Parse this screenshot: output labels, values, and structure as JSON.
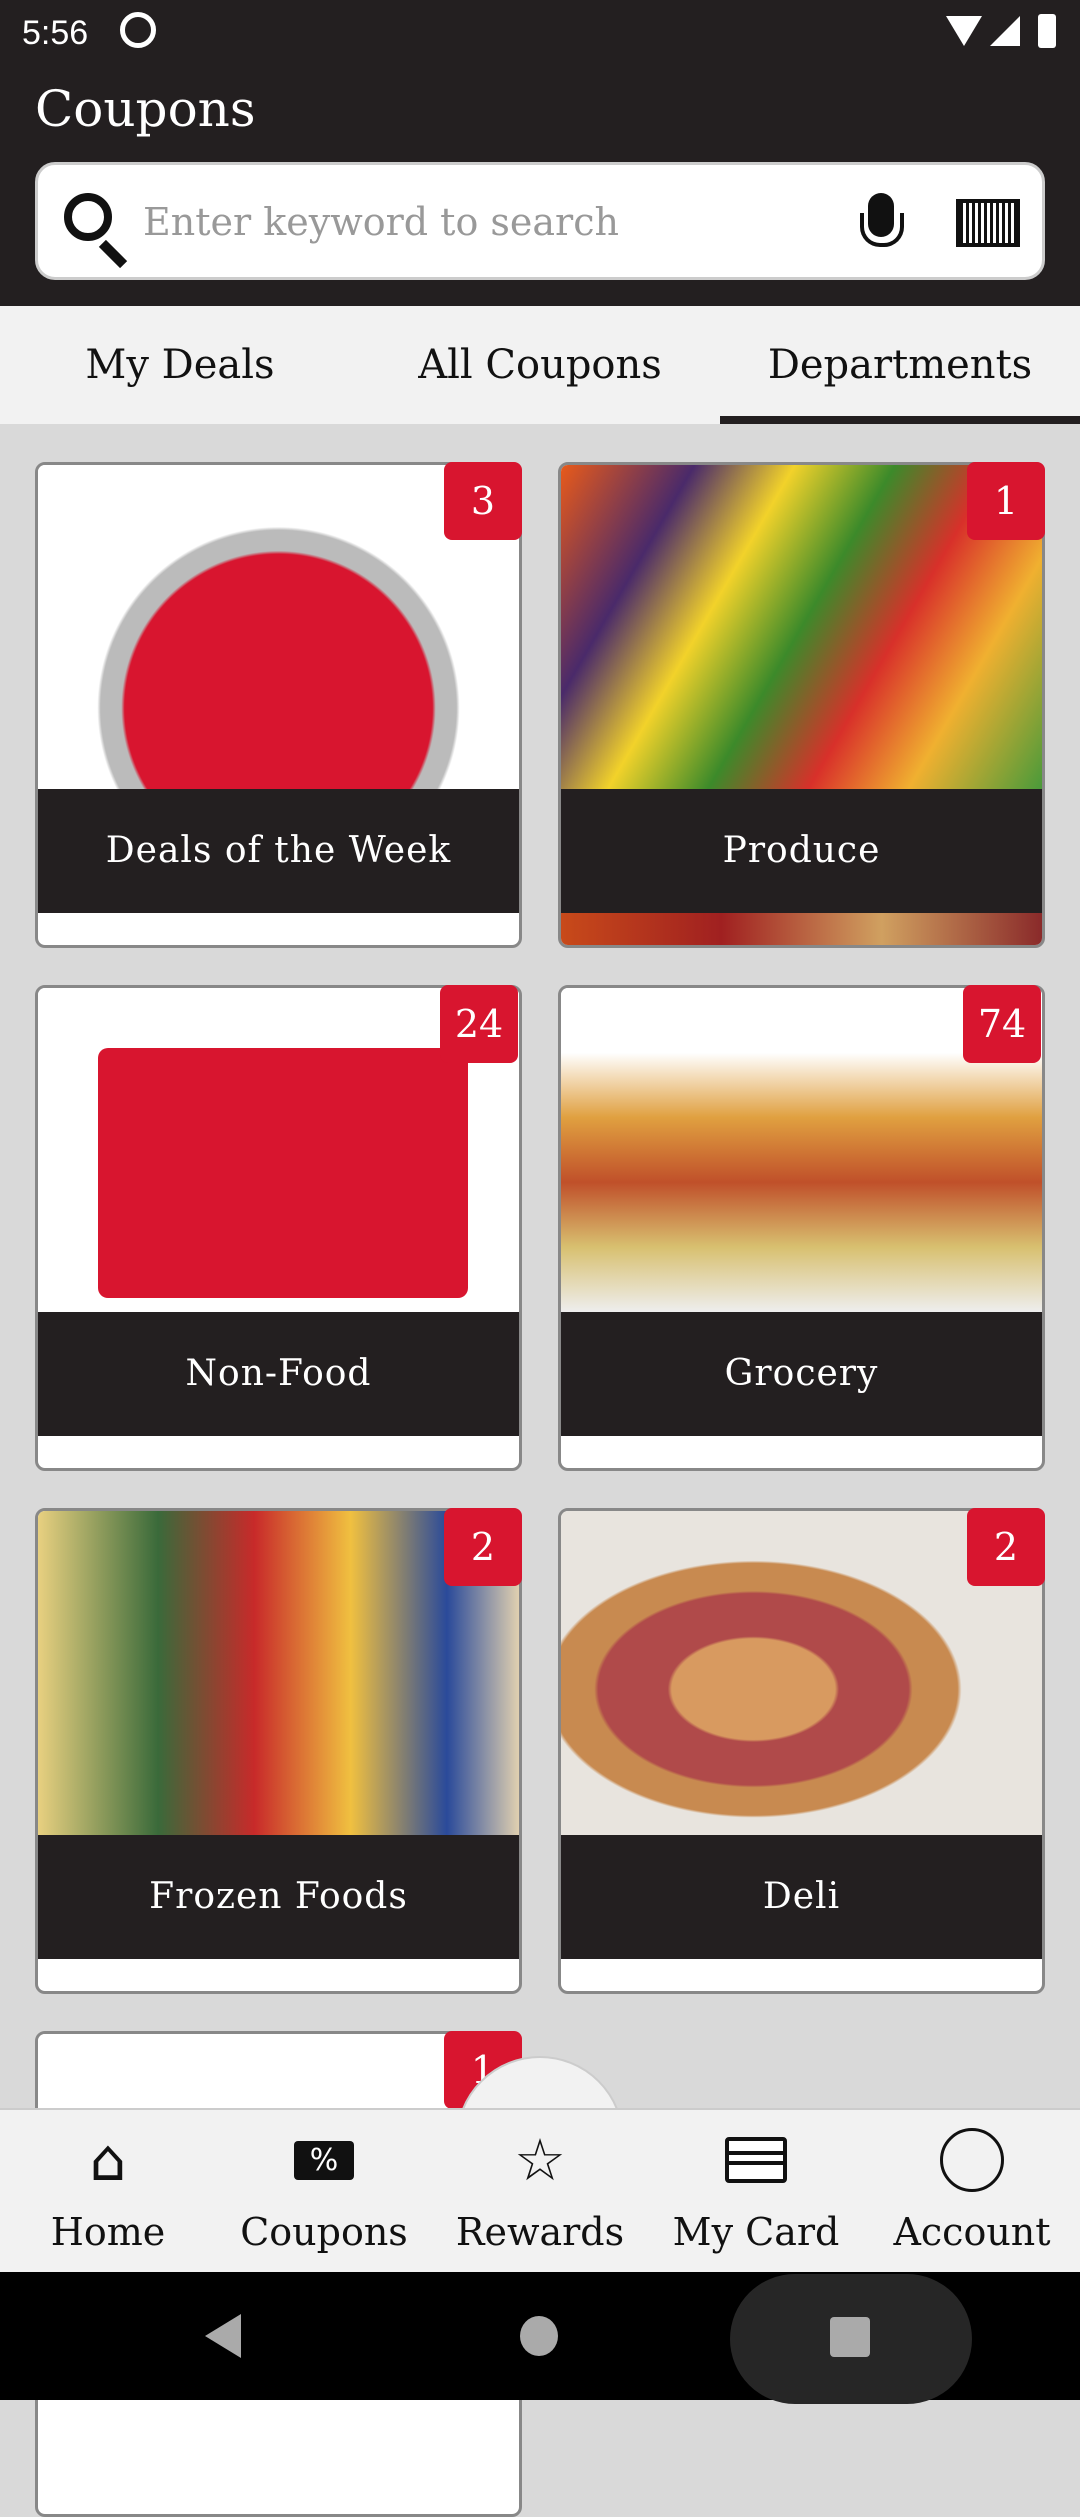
{
  "status_bar": {
    "time": "5:56"
  },
  "header": {
    "title": "Coupons",
    "search_placeholder": "Enter keyword to search"
  },
  "tabs": [
    {
      "label": "My Deals",
      "active": false
    },
    {
      "label": "All Coupons",
      "active": false
    },
    {
      "label": "Departments",
      "active": true
    }
  ],
  "departments": [
    {
      "label": "Deals of the Week",
      "count": "3"
    },
    {
      "label": "Produce",
      "count": "1"
    },
    {
      "label": "Non-Food",
      "count": "24"
    },
    {
      "label": "Grocery",
      "count": "74"
    },
    {
      "label": "Frozen Foods",
      "count": "2"
    },
    {
      "label": "Deli",
      "count": "2"
    },
    {
      "label": "",
      "count": "1"
    }
  ],
  "bottom_nav": [
    {
      "label": "Home",
      "icon": "home-icon"
    },
    {
      "label": "Coupons",
      "icon": "coupon-icon"
    },
    {
      "label": "Rewards",
      "icon": "rewards-icon"
    },
    {
      "label": "My Card",
      "icon": "card-icon"
    },
    {
      "label": "Account",
      "icon": "account-icon"
    }
  ],
  "colors": {
    "header": "#231f20",
    "badge": "#d8152f",
    "background": "#d9d9d9"
  }
}
